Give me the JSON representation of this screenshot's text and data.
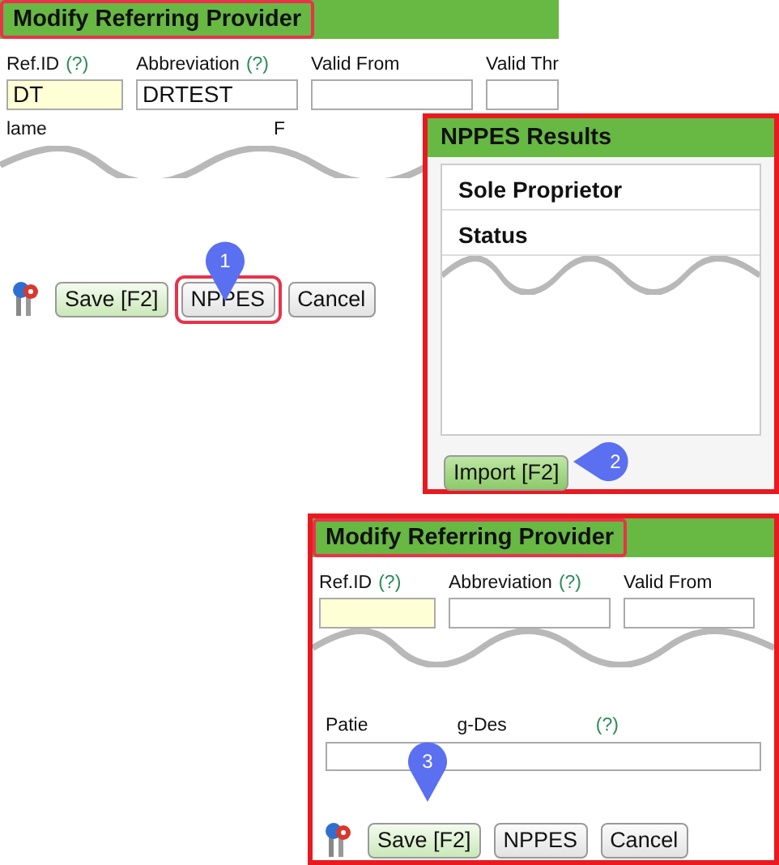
{
  "panels": [
    {
      "kind": "form",
      "framed": false,
      "title": "Modify Referring Provider",
      "title_highlighted": true,
      "fields": [
        {
          "label": "Ref.ID",
          "help": "(?)",
          "value": "DT",
          "highlighted": true
        },
        {
          "label": "Abbreviation",
          "help": "(?)",
          "value": "DRTEST",
          "highlighted": false
        },
        {
          "label": "Valid From",
          "highlighted": false
        },
        {
          "label": "Valid Thr",
          "highlighted": false
        }
      ],
      "fragments": [
        "lame",
        "F"
      ],
      "buttons": [
        {
          "label": "Save [F2]",
          "kind": "save",
          "highlighted": false
        },
        {
          "label": "NPPES",
          "kind": "plain",
          "highlighted": true
        },
        {
          "label": "Cancel",
          "kind": "plain",
          "highlighted": false
        }
      ],
      "callout": {
        "number": "1",
        "kind": "down"
      }
    },
    {
      "kind": "results",
      "framed": true,
      "title": "NPPES Results",
      "title_highlighted": false,
      "rows": [
        "Sole Proprietor",
        "Status"
      ],
      "buttons": [
        {
          "label": "Import [F2]",
          "kind": "import",
          "highlighted": false
        }
      ],
      "callout": {
        "number": "2",
        "kind": "left"
      }
    },
    {
      "kind": "form",
      "framed": true,
      "title": "Modify Referring Provider",
      "title_highlighted": true,
      "fields": [
        {
          "label": "Ref.ID",
          "help": "(?)",
          "highlighted": true
        },
        {
          "label": "Abbreviation",
          "help": "(?)",
          "highlighted": false
        },
        {
          "label": "Valid From",
          "highlighted": false
        }
      ],
      "fragments": [
        "Patie",
        "g-Des",
        "(?)"
      ],
      "buttons": [
        {
          "label": "Save [F2]",
          "kind": "save",
          "highlighted": false
        },
        {
          "label": "NPPES",
          "kind": "plain",
          "highlighted": false
        },
        {
          "label": "Cancel",
          "kind": "plain",
          "highlighted": false
        }
      ],
      "callout": {
        "number": "3",
        "kind": "down"
      }
    }
  ]
}
